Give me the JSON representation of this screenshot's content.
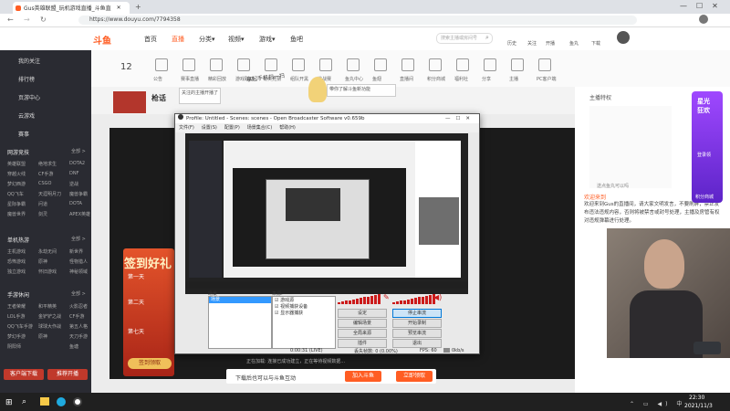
{
  "browser": {
    "tab_title": "Gus英雄联盟_玩机游戏直播_斗鱼直",
    "url": "https://www.douyu.com/7794358",
    "tab_close": "✕"
  },
  "site": {
    "logo": "斗鱼",
    "nav": [
      "首页",
      "直播",
      "分类▾",
      "视频▾",
      "游戏▾",
      "鱼吧"
    ],
    "search_placeholder": "搜索主播或房间号",
    "top_icons": [
      "历史",
      "关注",
      "开播",
      "鱼丸",
      "下载"
    ]
  },
  "sidebar": {
    "top_items": [
      "我的关注",
      "排行榜",
      "页游中心",
      "云游戏",
      "赛事"
    ],
    "groups": [
      {
        "title": "网游竞技",
        "more": "全部 >",
        "rows": [
          [
            "英雄联盟",
            "绝地求生",
            "DOTA2"
          ],
          [
            "穿越火线",
            "CF手游",
            "DNF"
          ],
          [
            "梦幻西游",
            "CSGO",
            "逆战"
          ],
          [
            "QQ飞车",
            "天涯明月刀",
            "魔兽争霸"
          ],
          [
            "星际争霸",
            "问道",
            "DOTA"
          ],
          [
            "魔兽世界",
            "剑灵",
            "APEX英雄"
          ]
        ]
      },
      {
        "title": "单机热游",
        "more": "全部 >",
        "rows": [
          [
            "主机游戏",
            "永劫无间",
            "新世界"
          ],
          [
            "恐怖游戏",
            "原神",
            "怪物猎人"
          ],
          [
            "独立游戏",
            "怀旧游戏",
            "神秘领域"
          ]
        ]
      },
      {
        "title": "手游休闲",
        "more": "全部 >",
        "rows": [
          [
            "王者荣耀",
            "和平精英",
            "火影忍者"
          ],
          [
            "LOL手游",
            "金铲铲之战",
            "CF手游"
          ],
          [
            "QQ飞车手游",
            "球球大作战",
            "第五人格"
          ],
          [
            "梦幻手游",
            "原神",
            "天刀手游"
          ],
          [
            "阴阳师",
            "",
            "鱼塘"
          ]
        ]
      }
    ],
    "buttons": [
      "客户端下载",
      "推荐开播"
    ]
  },
  "categories": [
    "公告",
    "赛事直播",
    "精彩回放",
    "游戏联动",
    "有奖竞猜",
    "组队开黑",
    "挑战赛",
    "鱼丸中心",
    "鱼翅",
    "直播间",
    "积分商城",
    "福利社",
    "分享",
    "主播",
    "PC客户端"
  ],
  "room": {
    "level": "12",
    "title": "枪话",
    "bubble1": "关注的主播开播了",
    "bubble2": "带你了解斗鱼新功能",
    "hint": "拿起手机扫一扫"
  },
  "promo": {
    "sign_text": "签到好礼",
    "days": [
      "第一天",
      "第二天",
      "第七天"
    ],
    "bottom_text": "签到领取",
    "download_text": "下载后也可以与斗鱼互动",
    "btn1": "加入斗鱼",
    "btn2": "立即领取",
    "status": "正在加载: 连接已成功建立，正在等待视频数据..."
  },
  "obs": {
    "title": "Profile: Untitled - Scenes: scenes - Open Broadcaster Software v0.659b",
    "menu": [
      "文件(F)",
      "设置(S)",
      "配置(P)",
      "场景集合(C)",
      "帮助(H)"
    ],
    "scenes_label": "场景",
    "scene_item": "场景",
    "sources_label": "来源:",
    "sources": [
      "游戏源",
      "视频捕获设备",
      "显示器捕获"
    ],
    "buttons_left": [
      "设定",
      "编辑场景",
      "全局来源",
      "插件"
    ],
    "buttons_right": [
      "停止串流",
      "开始录制",
      "预览串流",
      "退出"
    ],
    "status_time": "0:00:31 (LIVE)",
    "status_drop": "丢失帧数: 0 (0.00%)",
    "status_fps": "FPS: 60",
    "status_rate": "0kb/s"
  },
  "right": {
    "welcome_label": "欢迎来到",
    "anchor_notice": "主播特权",
    "chat_text": "欢迎来到Gus的直播间，请大家文明发言，不要刷屏，禁止发布违法违规内容，否则将被禁言或封号处理，主播及房管有权对违规弹幕进行处理。",
    "side_badges": [
      "星光",
      "狂欢",
      "登录领",
      "积分商城"
    ],
    "dialog": "送点鱼丸可以吗"
  },
  "taskbar": {
    "time": "22:30",
    "date": "2021/11/3"
  },
  "colors": {
    "accent": "#ff5d23",
    "sidebar": "#2a2b32",
    "obs_level_red": "#cc1b1b"
  }
}
